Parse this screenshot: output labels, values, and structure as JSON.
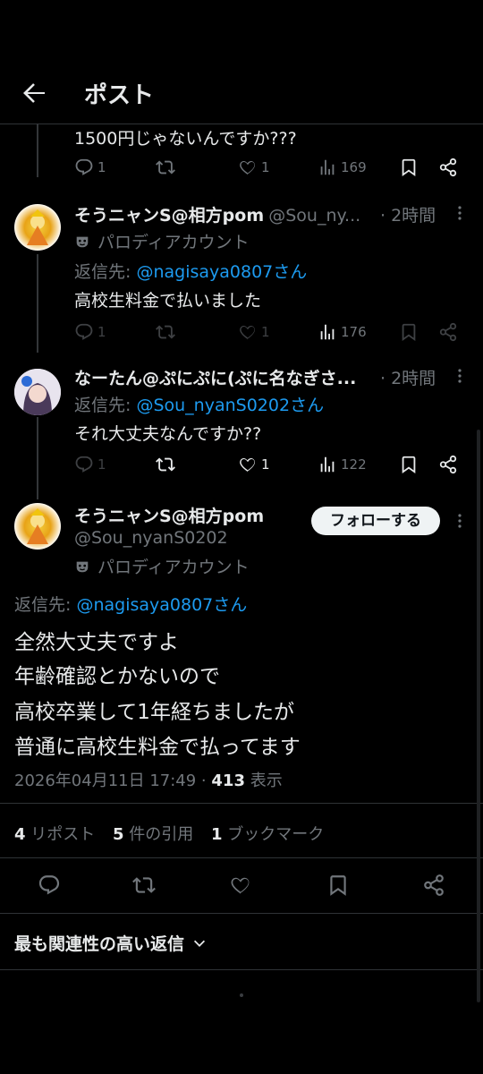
{
  "header": {
    "title": "ポスト"
  },
  "replies": [
    {
      "text": "1500円じゃないんですか???",
      "stats": {
        "reply": "1",
        "retweet": "",
        "like": "1",
        "views": "169"
      }
    },
    {
      "name": "そうニャンS@相方pom",
      "handle": "@Sou_ny...",
      "time": "· 2時間",
      "parody_label": "パロディアカウント",
      "reply_prefix": "返信先: ",
      "reply_to": "@nagisaya0807さん",
      "text": "高校生料金で払いました",
      "stats": {
        "reply": "1",
        "retweet": "",
        "like": "1",
        "views": "176"
      }
    },
    {
      "name": "なーたん@ぷにぷに(ぷに名なぎさ...",
      "time": "· 2時間",
      "reply_prefix": "返信先: ",
      "reply_to": "@Sou_nyanS0202さん",
      "text": "それ大丈夫なんですか??",
      "stats": {
        "reply": "1",
        "retweet": "",
        "like": "1",
        "views": "122"
      }
    }
  ],
  "main_post": {
    "name": "そうニャンS@相方pom",
    "handle": "@Sou_nyanS0202",
    "follow_label": "フォローする",
    "parody_label": "パロディアカウント",
    "reply_prefix": "返信先: ",
    "reply_to": "@nagisaya0807さん",
    "lines": [
      "全然大丈夫ですよ",
      "年齢確認とかないので",
      "高校卒業して1年経ちましたが",
      "普通に高校生料金で払ってます"
    ],
    "timestamp": "2026年04月11日 17:49 · ",
    "views_count": "413",
    "views_label": " 表示",
    "reposts_count": "4",
    "reposts_label": " リポスト",
    "quotes_count": "5",
    "quotes_label": " 件の引用",
    "bookmarks_count": "1",
    "bookmarks_label": " ブックマーク"
  },
  "sort": {
    "label": "最も関連性の高い返信"
  },
  "colors": {
    "link": "#1d9bf0",
    "muted": "#71767b",
    "text": "#e7e9ea",
    "bg": "#000000"
  },
  "icons": [
    "back-arrow-icon",
    "reply-icon",
    "retweet-icon",
    "like-icon",
    "views-icon",
    "bookmark-icon",
    "share-icon",
    "more-icon",
    "parody-mask-icon",
    "chevron-down-icon"
  ]
}
